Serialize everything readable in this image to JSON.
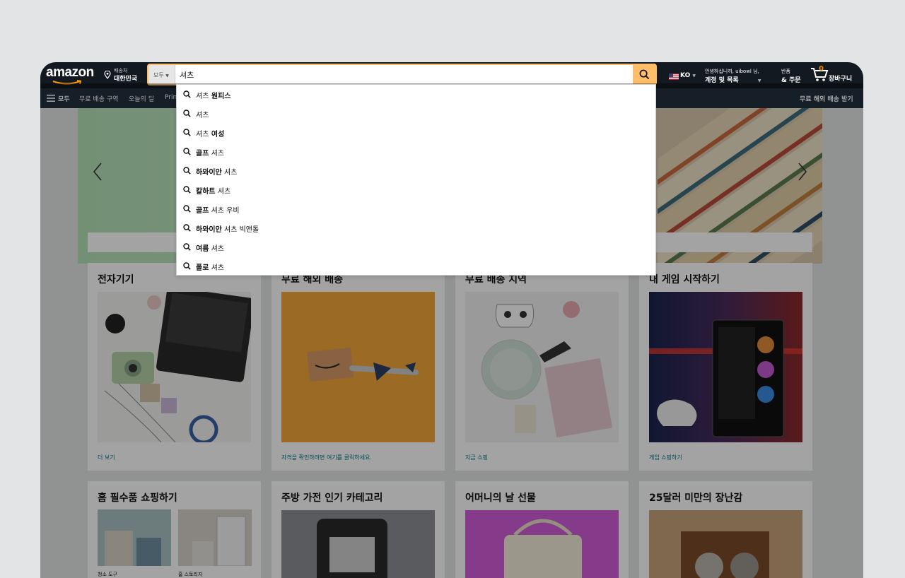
{
  "header": {
    "logo_text": "amazon",
    "deliver_line1": "배송처",
    "deliver_line2": "대한민국",
    "search_category": "모두",
    "search_value": "셔츠",
    "language": "KO",
    "account_line1": "안녕하십니까, uibowl 님,",
    "account_line2": "계정 및 목록",
    "returns_line1": "반품",
    "returns_line2": "& 주문",
    "cart_count": "0",
    "cart_label": "장바구니"
  },
  "subnav": {
    "all": "모두",
    "items": [
      "무료 배송 구역",
      "오늘의 딜",
      "Prin"
    ],
    "right": "무료 해외 배송 받기"
  },
  "suggestions": [
    {
      "typed": "셔츠",
      "rest": " 원피스"
    },
    {
      "typed": "셔츠",
      "rest": ""
    },
    {
      "typed": "셔츠",
      "rest": " 여성"
    },
    {
      "typed": "골프",
      "rest": " 셔츠"
    },
    {
      "typed": "하와이안",
      "rest": " 셔츠"
    },
    {
      "typed": "칼하트",
      "rest": " 셔츠"
    },
    {
      "typed": "골프",
      "rest": " 셔츠 우비"
    },
    {
      "typed": "하와이안",
      "rest": " 셔츠 빅앤톨"
    },
    {
      "typed": "여름",
      "rest": " 셔츠"
    },
    {
      "typed": "폴로",
      "rest": " 셔츠"
    }
  ],
  "cards_row1": [
    {
      "title": "전자기기",
      "link": "더 보기"
    },
    {
      "title": "무료 해외 배송",
      "link": "자격을 확인하려면 여기를 클릭하세요."
    },
    {
      "title": "무료 배송 지역",
      "link": "지금 쇼핑"
    },
    {
      "title": "내 게임 시작하기",
      "link": "게임 쇼핑하기"
    }
  ],
  "cards_row2": [
    {
      "title": "홈 필수품 쇼핑하기",
      "mini": [
        "청소 도구",
        "홈 스토리지"
      ]
    },
    {
      "title": "주방 가전 인기 카테고리"
    },
    {
      "title": "어머니의 날 선물"
    },
    {
      "title": "25달러 미만의 장난감"
    }
  ],
  "colors": {
    "topbar": "#131921",
    "subnav": "#232f3e",
    "search_button": "#febd69",
    "cart_count": "#f08804"
  }
}
